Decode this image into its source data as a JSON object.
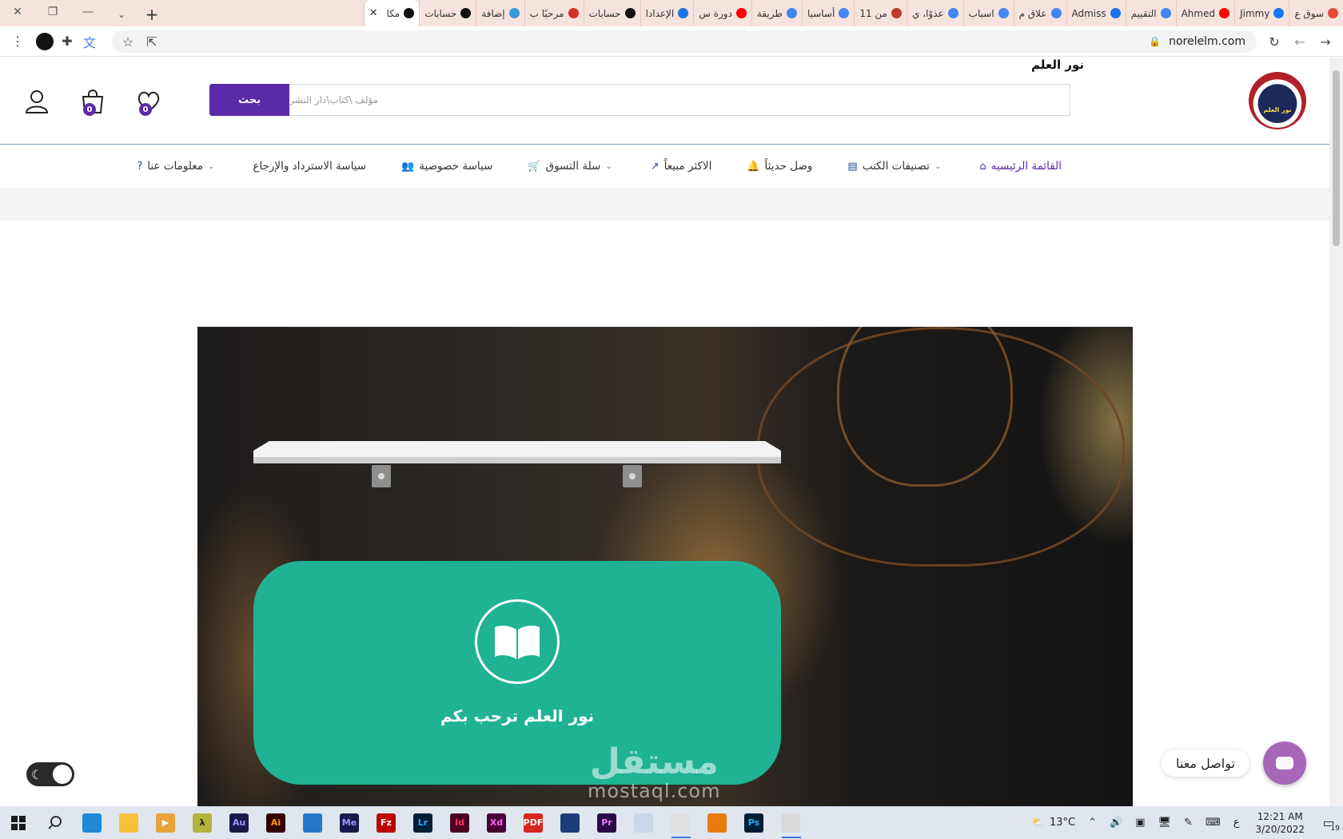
{
  "browser": {
    "tabs": [
      {
        "title": "سوق ع",
        "favicon_color": "#e44c3a"
      },
      {
        "title": "Jimmy",
        "favicon_color": "#1877f2"
      },
      {
        "title": "Ahmed",
        "favicon_color": "#ff0000"
      },
      {
        "title": "التقييم",
        "favicon_color": "#4285f4"
      },
      {
        "title": "Admiss",
        "favicon_color": "#1a73e8"
      },
      {
        "title": "علاق م",
        "favicon_color": "#4285f4"
      },
      {
        "title": "اسباب",
        "favicon_color": "#4285f4"
      },
      {
        "title": "عذوًا، ي",
        "favicon_color": "#4285f4"
      },
      {
        "title": "11 من",
        "favicon_color": "#c0392b"
      },
      {
        "title": "أساسيا",
        "favicon_color": "#4285f4"
      },
      {
        "title": "طريقة",
        "favicon_color": "#4285f4"
      },
      {
        "title": "دورة س",
        "favicon_color": "#ff0000"
      },
      {
        "title": "الإعدادا",
        "favicon_color": "#1a73e8"
      },
      {
        "title": "حسابات",
        "favicon_color": "#111111"
      },
      {
        "title": "مرحبًا ب",
        "favicon_color": "#d93025"
      },
      {
        "title": "إضافة",
        "favicon_color": "#3a9ad9"
      },
      {
        "title": "حسابات",
        "favicon_color": "#111111"
      },
      {
        "title": "مكا",
        "favicon_color": "#111111",
        "active": true
      }
    ],
    "new_tab_symbol": "+",
    "url": "norelelm.com"
  },
  "site": {
    "name": "نور العلم",
    "logo_text": "نور العلم",
    "search": {
      "placeholder": "مؤلف \\كتاب\\دار النشر",
      "button_label": "بحث"
    },
    "wishlist_count": "0",
    "cart_count": "0",
    "nav": [
      {
        "label": "القائمة الرئيسيه",
        "icon": "home-icon",
        "glyph": "⌂",
        "active": true,
        "caret": false
      },
      {
        "label": "تصنيفات الكتب",
        "icon": "book-list-icon",
        "glyph": "▤",
        "caret": true
      },
      {
        "label": "وصل حديثاً",
        "icon": "bell-icon",
        "glyph": "🔔",
        "caret": false
      },
      {
        "label": "الاكثر مبيعاً",
        "icon": "trending-icon",
        "glyph": "↗",
        "caret": false
      },
      {
        "label": "سلة التسوق",
        "icon": "cart-icon",
        "glyph": "🛒",
        "caret": true
      },
      {
        "label": "سياسة خصوصية",
        "icon": "users-icon",
        "glyph": "👥",
        "caret": false
      },
      {
        "label": "سياسة الاسترداد والإرجاع",
        "icon": "",
        "glyph": "",
        "caret": false
      },
      {
        "label": "معلومات عنا",
        "icon": "question-icon",
        "glyph": "?",
        "caret": true
      }
    ],
    "hero": {
      "welcome_text": "نور العلم ترحب بكم"
    },
    "contact_label": "تواصل معنا",
    "watermark": {
      "ar": "مستقل",
      "en": "mostaql.com"
    },
    "colors": {
      "primary": "#5b2aa8",
      "card": "#1fb393",
      "contact": "#a866b8"
    }
  },
  "taskbar": {
    "apps": [
      {
        "name": "edge",
        "label": "",
        "bg": "#1e8ad6",
        "fg": "#ffffff"
      },
      {
        "name": "file-explorer",
        "label": "",
        "bg": "#f3c13a",
        "fg": "#ffffff"
      },
      {
        "name": "media-player",
        "label": "▶",
        "bg": "#e8a33b",
        "fg": "#ffffff"
      },
      {
        "name": "lambda-app",
        "label": "λ",
        "bg": "#b4b23a",
        "fg": "#222222"
      },
      {
        "name": "audition",
        "label": "Au",
        "bg": "#1a1a4a",
        "fg": "#9999ff"
      },
      {
        "name": "illustrator",
        "label": "Ai",
        "bg": "#330000",
        "fg": "#ff9a00"
      },
      {
        "name": "vscode",
        "label": "",
        "bg": "#2478cc",
        "fg": "#ffffff"
      },
      {
        "name": "media-encoder",
        "label": "Me",
        "bg": "#1a1a4a",
        "fg": "#9999ff"
      },
      {
        "name": "filezilla",
        "label": "Fz",
        "bg": "#bf0000",
        "fg": "#ffffff"
      },
      {
        "name": "lightroom",
        "label": "Lr",
        "bg": "#001e36",
        "fg": "#31a8ff"
      },
      {
        "name": "indesign",
        "label": "Id",
        "bg": "#49021f",
        "fg": "#ff3366"
      },
      {
        "name": "xd",
        "label": "Xd",
        "bg": "#470137",
        "fg": "#ff61f6"
      },
      {
        "name": "acrobat",
        "label": "PDF",
        "bg": "#d9261c",
        "fg": "#ffffff"
      },
      {
        "name": "cinema4d",
        "label": "",
        "bg": "#1f3c7a",
        "fg": "#ffffff"
      },
      {
        "name": "premiere",
        "label": "Pr",
        "bg": "#2a0b47",
        "fg": "#ea77ff"
      },
      {
        "name": "app-gear",
        "label": "",
        "bg": "#c9d6ea",
        "fg": "#333333"
      },
      {
        "name": "chrome",
        "label": "",
        "bg": "#e0e0e0",
        "fg": "#333333",
        "running": true
      },
      {
        "name": "blender",
        "label": "",
        "bg": "#e87d0d",
        "fg": "#ffffff"
      },
      {
        "name": "photoshop",
        "label": "Ps",
        "bg": "#001e36",
        "fg": "#31a8ff"
      },
      {
        "name": "chrome-profile",
        "label": "",
        "bg": "#d9d9d9",
        "fg": "#333333",
        "running": true
      }
    ],
    "weather": "13°C",
    "language": "ع",
    "time": "12:21 AM",
    "date": "3/20/2022",
    "notifications": "19"
  }
}
